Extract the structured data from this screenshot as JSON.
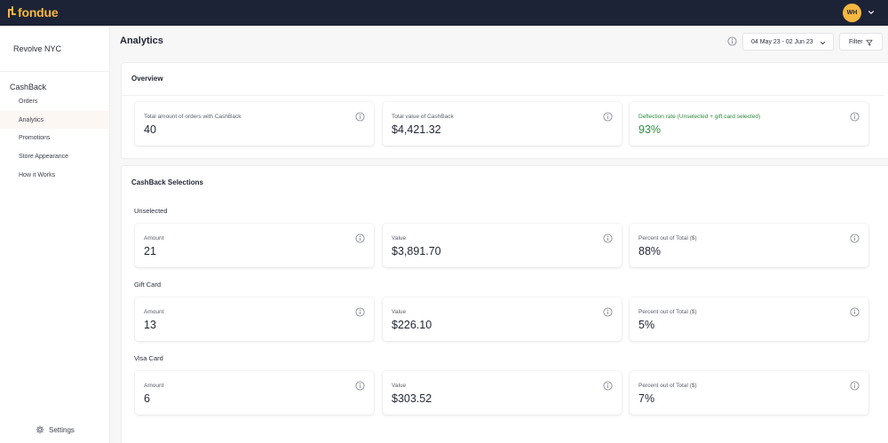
{
  "brand": {
    "name": "fondue",
    "accent": "#f4b740",
    "navbar_bg": "#1d2336"
  },
  "user": {
    "initials": "WH",
    "menu_icon": "chevron-down-icon"
  },
  "sidebar": {
    "store_name": "Revolve NYC",
    "section": "CashBack",
    "items": [
      {
        "label": "Orders",
        "active": false
      },
      {
        "label": "Analytics",
        "active": true
      },
      {
        "label": "Promotions",
        "active": false
      },
      {
        "label": "Store Appearance",
        "active": false
      },
      {
        "label": "How it Works",
        "active": false
      }
    ],
    "settings_label": "Settings",
    "settings_icon": "gear-icon"
  },
  "header": {
    "title": "Analytics",
    "info_icon": "info-icon",
    "date_range": "04 May 23 - 02 Jun 23",
    "filter_label": "Filter",
    "filter_icon": "funnel-icon"
  },
  "overview": {
    "title": "Overview",
    "cards": [
      {
        "label": "Total amount of orders with CashBack",
        "value": "40"
      },
      {
        "label": "Total value of CashBack",
        "value": "$4,421.32"
      },
      {
        "label": "Deflection rate (Unselected + gift card selected)",
        "value": "93%",
        "color": "#2f8a3f"
      }
    ]
  },
  "selections": {
    "title": "CashBack Selections",
    "groups": [
      {
        "label": "Unselected",
        "cards": [
          {
            "label": "Amount",
            "value": "21"
          },
          {
            "label": "Value",
            "value": "$3,891.70"
          },
          {
            "label": "Percent out of Total ($)",
            "value": "88%"
          }
        ]
      },
      {
        "label": "Gift Card",
        "cards": [
          {
            "label": "Amount",
            "value": "13"
          },
          {
            "label": "Value",
            "value": "$226.10"
          },
          {
            "label": "Percent out of Total ($)",
            "value": "5%"
          }
        ]
      },
      {
        "label": "Visa Card",
        "cards": [
          {
            "label": "Amount",
            "value": "6"
          },
          {
            "label": "Value",
            "value": "$303.52"
          },
          {
            "label": "Percent out of Total ($)",
            "value": "7%"
          }
        ]
      }
    ]
  }
}
